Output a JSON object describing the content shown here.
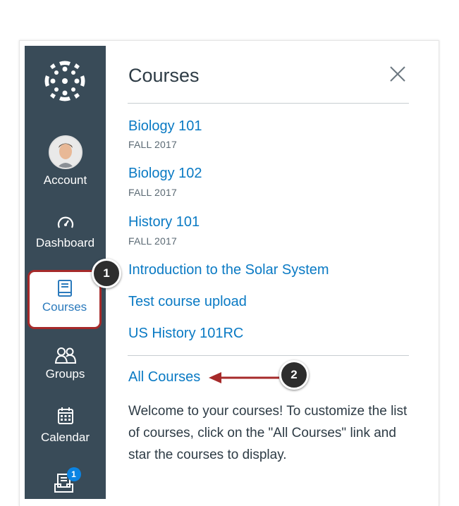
{
  "nav": {
    "account_label": "Account",
    "dashboard_label": "Dashboard",
    "courses_label": "Courses",
    "groups_label": "Groups",
    "calendar_label": "Calendar",
    "inbox_badge": "1"
  },
  "tray": {
    "title": "Courses",
    "courses": [
      {
        "name": "Biology 101",
        "term": "FALL 2017"
      },
      {
        "name": "Biology 102",
        "term": "FALL 2017"
      },
      {
        "name": "History 101",
        "term": "FALL 2017"
      },
      {
        "name": "Introduction to the Solar System"
      },
      {
        "name": "Test course upload"
      },
      {
        "name": "US History 101RC"
      }
    ],
    "all_courses_label": "All Courses",
    "welcome_text": "Welcome to your courses! To customize the list of courses, click on the \"All Courses\" link and star the courses to display."
  },
  "callouts": {
    "first": "1",
    "second": "2"
  },
  "colors": {
    "nav_bg": "#394b58",
    "link": "#0a7ac4",
    "highlight_border": "#a62a2a",
    "badge": "#0b84e3"
  },
  "icons": [
    "canvas-logo-icon",
    "avatar-icon",
    "dashboard-icon",
    "courses-icon",
    "groups-icon",
    "calendar-icon",
    "inbox-icon",
    "close-icon"
  ]
}
